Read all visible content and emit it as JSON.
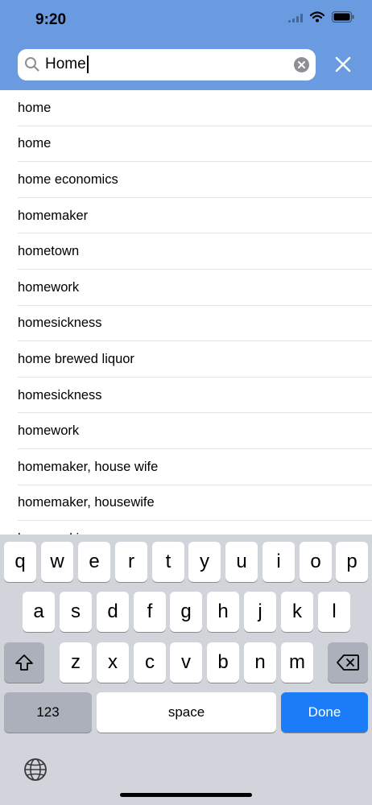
{
  "status_bar": {
    "time": "9:20"
  },
  "search": {
    "query": "Home"
  },
  "results": [
    "home",
    "home",
    "home economics",
    "homemaker",
    "hometown",
    "homework",
    "homesickness",
    "home brewed liquor",
    "homesickness",
    "homework",
    "homemaker, house wife",
    "homemaker, housewife",
    "homemaking"
  ],
  "keyboard": {
    "row1": [
      "q",
      "w",
      "e",
      "r",
      "t",
      "y",
      "u",
      "i",
      "o",
      "p"
    ],
    "row2": [
      "a",
      "s",
      "d",
      "f",
      "g",
      "h",
      "j",
      "k",
      "l"
    ],
    "row3": [
      "z",
      "x",
      "c",
      "v",
      "b",
      "n",
      "m"
    ],
    "numbers_label": "123",
    "space_label": "space",
    "done_label": "Done"
  },
  "icons": [
    "signal-icon",
    "wifi-icon",
    "battery-icon",
    "search-icon",
    "clear-text-icon",
    "close-icon",
    "shift-icon",
    "backspace-icon",
    "globe-icon"
  ]
}
